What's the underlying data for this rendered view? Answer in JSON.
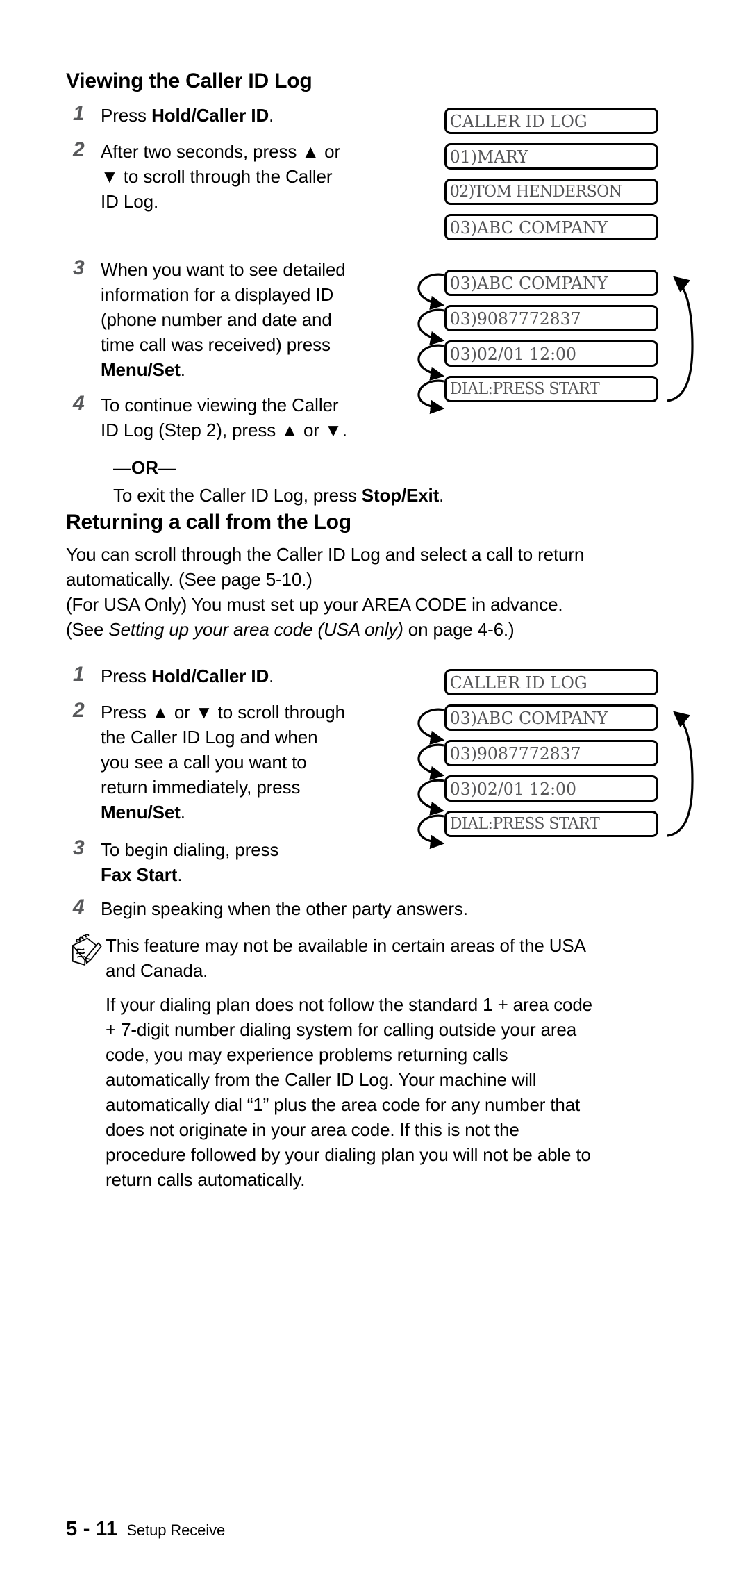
{
  "document": {
    "footer": {
      "page_number": "5 - 11",
      "chapter_label": "Setup Receive"
    }
  },
  "section_viewing": {
    "heading": "Viewing the Caller ID Log",
    "steps": [
      {
        "num": "1",
        "text_html": "Press <b>Hold/Caller ID</b>."
      },
      {
        "num": "2",
        "text_html": "After two seconds, press ▲ or<br>▼ to scroll through the Caller<br>ID Log."
      },
      {
        "num": "3",
        "text_html": "When you want to see detailed<br>information for a displayed ID<br>(phone number and date and<br>time call was received) press<br><b>Menu/Set</b>."
      },
      {
        "num": "4",
        "text_html": "To continue viewing the Caller<br>ID Log (Step 2), press ▲ or ▼."
      }
    ],
    "or_label_html": "—<b>OR</b>—",
    "exit_text_html": "To exit the Caller ID Log, press <b>Stop/Exit</b>.",
    "lcd_top": [
      "CALLER ID LOG",
      "01)MARY",
      "02)TOM HENDERSON",
      "03)ABC COMPANY"
    ],
    "lcd_cycle": [
      "03)ABC COMPANY",
      "03)9087772837",
      "03)02/01 12:00",
      "DIAL:PRESS START"
    ]
  },
  "section_returning": {
    "heading": "Returning a call from the Log",
    "intro_1_html": "You can scroll through the Caller ID Log and select a call to return<br>automatically. (See page 5-10.)",
    "intro_2_html": "(For USA Only) You must set up your AREA CODE in advance.<br>(See <i>Setting up your area code (USA only)</i> on page 4-6.)",
    "steps": [
      {
        "num": "1",
        "text_html": "Press <b>Hold/Caller ID</b>."
      },
      {
        "num": "2",
        "text_html": "Press ▲ or ▼ to scroll through<br>the Caller ID Log and when<br>you see a call you want to<br>return immediately, press<br><b>Menu/Set</b>."
      },
      {
        "num": "3",
        "text_html": "To begin dialing, press<br><b>Fax Start</b>."
      },
      {
        "num": "4",
        "text_html": "Begin speaking when the other party answers."
      }
    ],
    "lcd_header": "CALLER ID LOG",
    "lcd_cycle": [
      "03)ABC COMPANY",
      "03)9087772837",
      "03)02/01 12:00",
      "DIAL:PRESS START"
    ]
  },
  "note": {
    "icon": "notepad-pencil-icon",
    "lead_html": "This feature may not be available in certain areas of the USA<br>and Canada.",
    "body_html": "If your dialing plan does not follow the standard 1 + area code<br>+ 7-digit number dialing system for calling outside your area<br>code, you may experience problems returning calls<br>automatically from the Caller ID Log. Your machine will<br>automatically dial “1” plus the area code for any number that<br>does not originate in your area code. If this is not the<br>procedure followed by your dialing plan you will not be able to<br>return calls automatically."
  },
  "colors": {
    "text": "#000000",
    "step_number": "#58595b",
    "lcd_text": "#555557",
    "lcd_border": "#000000"
  }
}
